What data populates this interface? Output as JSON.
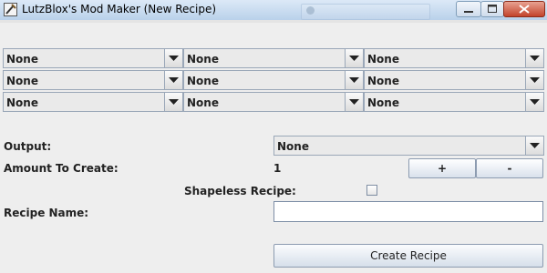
{
  "window": {
    "title": "LutzBlox's Mod Maker (New Recipe)"
  },
  "grid": {
    "rows": [
      [
        "None",
        "None",
        "None"
      ],
      [
        "None",
        "None",
        "None"
      ],
      [
        "None",
        "None",
        "None"
      ]
    ]
  },
  "output": {
    "label": "Output:",
    "value": "None"
  },
  "amount": {
    "label": "Amount To Create:",
    "value": "1",
    "plus_label": "+",
    "minus_label": "-"
  },
  "shapeless": {
    "label": "Shapeless Recipe:",
    "checked": false
  },
  "recipe_name": {
    "label": "Recipe Name:",
    "value": ""
  },
  "create_button": {
    "label": "Create Recipe"
  }
}
